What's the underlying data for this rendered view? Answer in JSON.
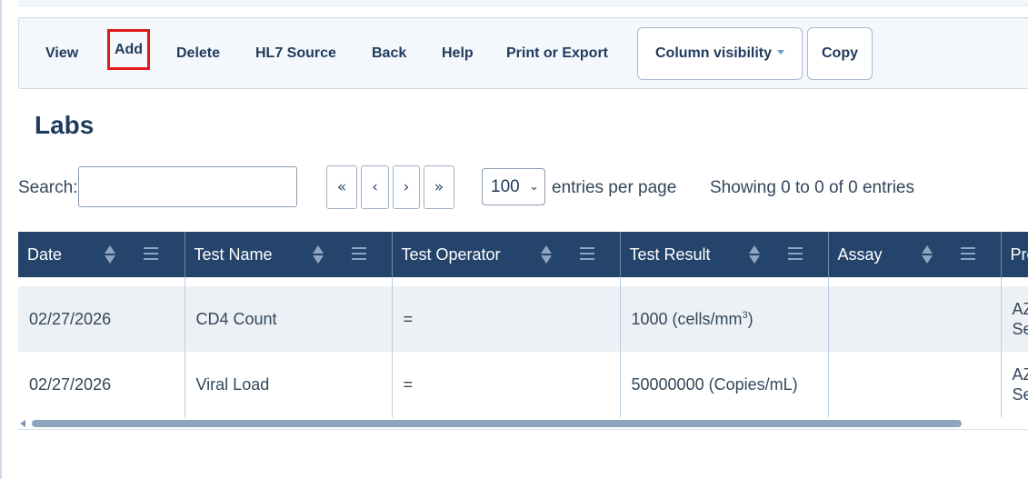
{
  "toolbar": {
    "view": "View",
    "add": "Add",
    "delete": "Delete",
    "hl7": "HL7 Source",
    "back": "Back",
    "help": "Help",
    "print": "Print or Export",
    "column_visibility": "Column visibility",
    "copy": "Copy"
  },
  "page": {
    "title": "Labs"
  },
  "search": {
    "label": "Search:",
    "value": ""
  },
  "pagination": {
    "first": "«",
    "prev": "‹",
    "next": "›",
    "last": "»"
  },
  "entries": {
    "per_page_value": "100",
    "per_page_label": "entries per page",
    "info": "Showing 0 to 0 of 0 entries"
  },
  "table": {
    "columns": [
      "Date",
      "Test Name",
      "Test Operator",
      "Test Result",
      "Assay",
      "Pro"
    ],
    "rows": [
      {
        "date": "02/27/2026",
        "test_name": "CD4 Count",
        "operator": "=",
        "result_prefix": "1000 (cells/mm",
        "result_sup": "3",
        "result_suffix": ")",
        "assay": "",
        "prov_line1": "AZ",
        "prov_line2": "Se"
      },
      {
        "date": "02/27/2026",
        "test_name": "Viral Load",
        "operator": "=",
        "result_prefix": "50000000 (Copies/mL)",
        "result_sup": "",
        "result_suffix": "",
        "assay": "",
        "prov_line1": "AZ",
        "prov_line2": "Se"
      }
    ]
  },
  "colors": {
    "header_bg": "#24446b",
    "highlight": "#e01919",
    "text": "#1f3a5c"
  }
}
